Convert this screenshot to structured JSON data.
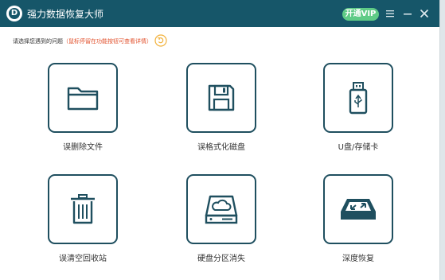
{
  "app": {
    "title": "强力数据恢复大师",
    "logo_glyph": "D"
  },
  "titlebar": {
    "vip_label": "开通VIP",
    "icons": [
      "menu-icon",
      "minimize-icon",
      "close-icon"
    ],
    "bg_color": "#165669",
    "vip_color": "#5fcb86"
  },
  "hint": {
    "main": "请选择您遇到的问题",
    "sub": "（鼠标停留在功能按钮可查看详情）",
    "icon": "refresh-arrow-icon"
  },
  "options": [
    {
      "label": "误删除文件",
      "icon": "folder-icon"
    },
    {
      "label": "误格式化磁盘",
      "icon": "floppy-disk-icon"
    },
    {
      "label": "U盘/存储卡",
      "icon": "usb-drive-icon"
    },
    {
      "label": "误清空回收站",
      "icon": "trash-bin-icon"
    },
    {
      "label": "硬盘分区消失",
      "icon": "hard-drive-cloud-icon"
    },
    {
      "label": "深度恢复",
      "icon": "deep-recovery-icon"
    }
  ]
}
